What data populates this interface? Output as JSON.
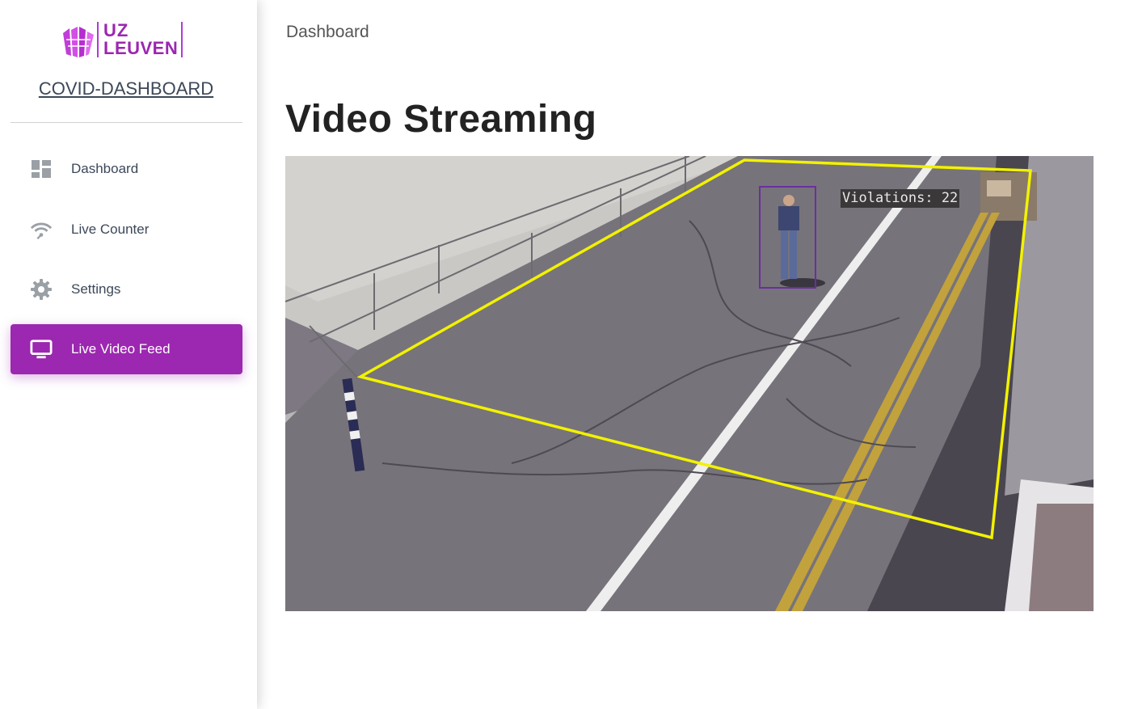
{
  "sidebar": {
    "logo": {
      "line1": "UZ",
      "line2": "LEUVEN"
    },
    "title": "COVID-DASHBOARD",
    "items": [
      {
        "label": "Dashboard",
        "icon": "dashboard-icon",
        "active": false
      },
      {
        "label": "Live Counter",
        "icon": "wifi-icon",
        "active": false
      },
      {
        "label": "Settings",
        "icon": "gear-icon",
        "active": false
      },
      {
        "label": "Live Video Feed",
        "icon": "monitor-icon",
        "active": true
      }
    ]
  },
  "header": {
    "breadcrumb": "Dashboard"
  },
  "main": {
    "title": "Video Streaming",
    "video": {
      "overlay_label": "Violations: 22",
      "roi_color": "#f2f200",
      "box_color": "#6a2fa0"
    }
  },
  "colors": {
    "accent": "#9c27b0",
    "icon_gray": "#9aa0a6"
  }
}
